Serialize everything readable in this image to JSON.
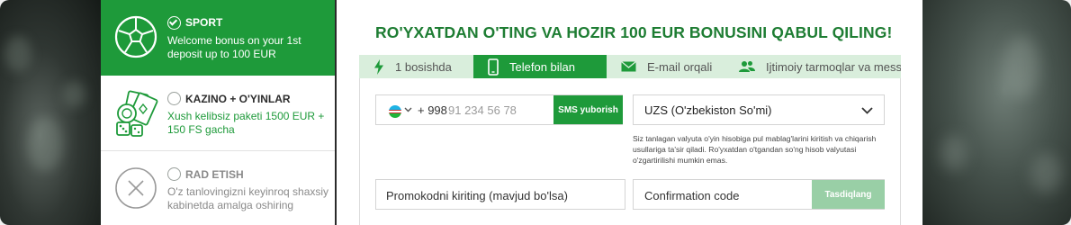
{
  "colors": {
    "accent": "#1e9a3a",
    "title_green": "#1e7d33",
    "tab_bg": "#d9eedc",
    "confirm_button_disabled": "#99cfa6"
  },
  "bonus_options": {
    "sport": {
      "icon": "soccer-ball-icon",
      "selected": true,
      "title": "SPORT",
      "description": "Welcome bonus on your 1st deposit up to 100 EUR"
    },
    "casino": {
      "icon": "casino-chips-cards-dice-icon",
      "selected": false,
      "title": "KAZINO + O'YINLAR",
      "description": "Xush kelibsiz paketi 1500 EUR + 150 FS gacha"
    },
    "cancel": {
      "icon": "close-circle-icon",
      "selected": false,
      "title": "RAD ETISH",
      "description": "O'z tanlovingizni keyinroq shaxsiy kabinetda amalga oshiring"
    }
  },
  "form": {
    "title": "RO'YXATDAN O'TING VA HOZIR 100 EUR BONUSINI QABUL QILING!",
    "tabs": [
      {
        "label": "1 bosishda",
        "icon": "lightning-icon",
        "active": false
      },
      {
        "label": "Telefon bilan",
        "icon": "phone-icon",
        "active": true
      },
      {
        "label": "E-mail orqali",
        "icon": "envelope-icon",
        "active": false
      },
      {
        "label": "Ijtimoiy tarmoqlar va mess...",
        "icon": "users-icon",
        "active": false
      }
    ],
    "phone": {
      "country_flag": "uzbekistan-flag-icon",
      "dial_code": "+ 998",
      "placeholder": "91 234 56 78",
      "sms_button": "SMS yuborish"
    },
    "currency": {
      "value": "UZS (O'zbekiston So'mi)",
      "note": "Siz tanlagan valyuta o'yin hisobiga pul mablag'larini kiritish va chiqarish usullariga ta'sir qiladi. Ro'yxatdan o'tgandan so'ng hisob valyutasi o'zgartirilishi mumkin emas."
    },
    "promo": {
      "placeholder": "Promokodni kiriting (mavjud bo'lsa)"
    },
    "confirmation": {
      "placeholder": "Confirmation code",
      "button": "Tasdiqlang"
    }
  }
}
